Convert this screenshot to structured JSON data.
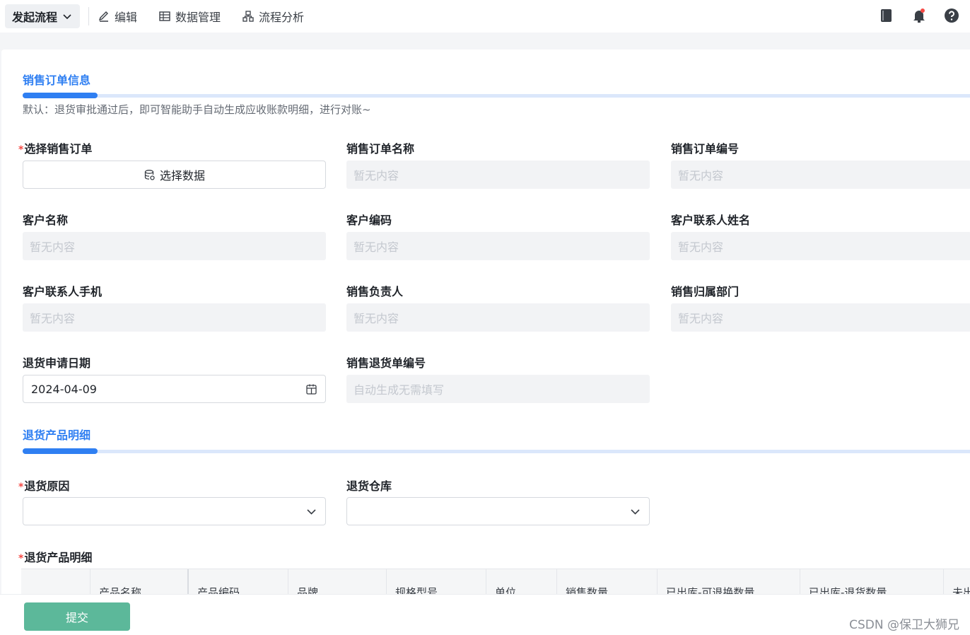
{
  "toolbar": {
    "launch_label": "发起流程",
    "edit_label": "编辑",
    "data_label": "数据管理",
    "analysis_label": "流程分析"
  },
  "sections": {
    "order_info_title": "销售订单信息",
    "order_info_hint": "默认：退货审批通过后，即可智能助手自动生成应收账款明细，进行对账~",
    "product_detail_title": "退货产品明细"
  },
  "fields": {
    "select_order": {
      "required_mark": "*",
      "label": "选择销售订单",
      "button_label": "选择数据"
    },
    "order_name": {
      "label": "销售订单名称",
      "placeholder": "暂无内容"
    },
    "order_no": {
      "label": "销售订单编号",
      "placeholder": "暂无内容"
    },
    "customer_name": {
      "label": "客户名称",
      "placeholder": "暂无内容"
    },
    "customer_code": {
      "label": "客户编码",
      "placeholder": "暂无内容"
    },
    "contact_name": {
      "label": "客户联系人姓名",
      "placeholder": "暂无内容"
    },
    "contact_phone": {
      "label": "客户联系人手机",
      "placeholder": "暂无内容"
    },
    "sales_owner": {
      "label": "销售负责人",
      "placeholder": "暂无内容"
    },
    "sales_dept": {
      "label": "销售归属部门",
      "placeholder": "暂无内容"
    },
    "return_date": {
      "label": "退货申请日期",
      "value": "2024-04-09"
    },
    "return_no": {
      "label": "销售退货单编号",
      "placeholder": "自动生成无需填写"
    },
    "return_reason": {
      "required_mark": "*",
      "label": "退货原因",
      "value": ""
    },
    "return_warehouse": {
      "label": "退货仓库",
      "value": ""
    },
    "return_products": {
      "required_mark": "*",
      "label": "退货产品明细"
    }
  },
  "table": {
    "headers": [
      "",
      "产品名称",
      "产品编码",
      "品牌",
      "规格型号",
      "单位",
      "销售数量",
      "已出库-可退换数量",
      "已出库-退货数量",
      "未出"
    ]
  },
  "footer": {
    "submit_label": "提交",
    "watermark": "CSDN @保卫大狮兄"
  }
}
